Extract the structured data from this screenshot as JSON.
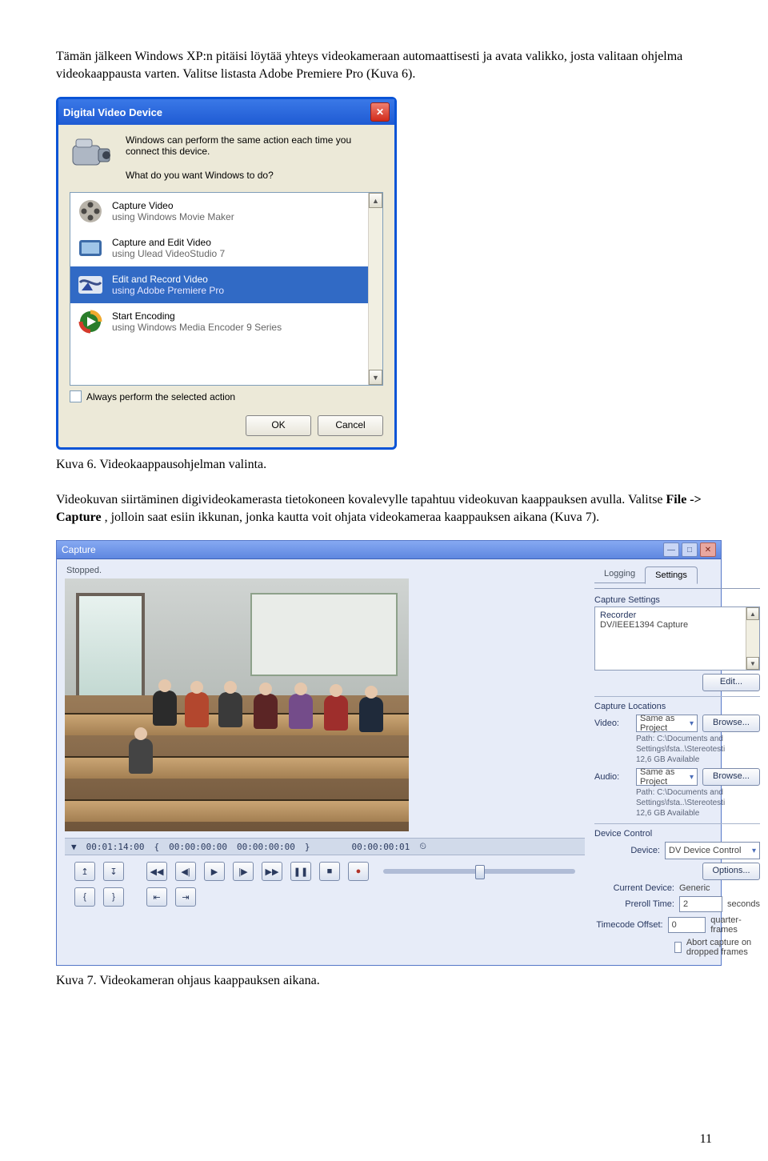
{
  "paragraphs": {
    "p1a": "Tämän jälkeen Windows XP:n pitäisi löytää yhteys videokameraan automaattisesti ja avata valikko, josta valitaan ohjelma videokaappausta varten. Valitse listasta Adobe Premiere Pro (Kuva 6).",
    "cap6": "Kuva 6. Videokaappausohjelman valinta.",
    "p2a": "Videokuvan siirtäminen digivideokamerasta tietokoneen kovalevylle tapahtuu videokuvan kaappauksen avulla. Valitse ",
    "p2b": "File -> Capture",
    "p2c": ", jolloin saat esiin ikkunan, jonka kautta voit ohjata videokameraa kaappauksen aikana (Kuva 7).",
    "cap7": "Kuva 7. Videokameran ohjaus kaappauksen aikana.",
    "page": "11"
  },
  "dialog1": {
    "title": "Digital Video Device",
    "intro": "Windows can perform the same action each time you connect this device.",
    "question": "What do you want Windows to do?",
    "items": [
      {
        "title": "Capture Video",
        "sub": "using Windows Movie Maker"
      },
      {
        "title": "Capture and Edit Video",
        "sub": "using Ulead VideoStudio 7"
      },
      {
        "title": "Edit and Record Video",
        "sub": "using Adobe Premiere Pro"
      },
      {
        "title": "Start Encoding",
        "sub": "using Windows Media Encoder 9 Series"
      }
    ],
    "always": "Always perform the selected action",
    "ok": "OK",
    "cancel": "Cancel"
  },
  "capture": {
    "title": "Capture",
    "status": "Stopped.",
    "tabs": {
      "logging": "Logging",
      "settings": "Settings"
    },
    "sections": {
      "capture_settings": "Capture Settings",
      "recorder": "Recorder",
      "recorder_value": "DV/IEEE1394 Capture",
      "edit": "Edit...",
      "capture_locations": "Capture Locations",
      "video": "Video:",
      "audio": "Audio:",
      "same": "Same as Project",
      "browse": "Browse...",
      "path": "Path:",
      "path_value": "C:\\Documents and Settings\\fsta..\\Stereotesti",
      "avail": "12,6 GB Available",
      "device_control": "Device Control",
      "device": "Device:",
      "device_value": "DV Device Control",
      "options": "Options...",
      "current_device": "Current Device:",
      "current_device_value": "Generic",
      "preroll": "Preroll Time:",
      "preroll_value": "2",
      "seconds": "seconds",
      "tc_offset": "Timecode Offset:",
      "tc_offset_value": "0",
      "qframes": "quarter-frames",
      "abort": "Abort capture on dropped frames"
    },
    "timecode": {
      "pos": "00:01:14:00",
      "in": "00:00:00:00",
      "out": "00:00:00:00",
      "dur": "00:00:00:01"
    }
  }
}
